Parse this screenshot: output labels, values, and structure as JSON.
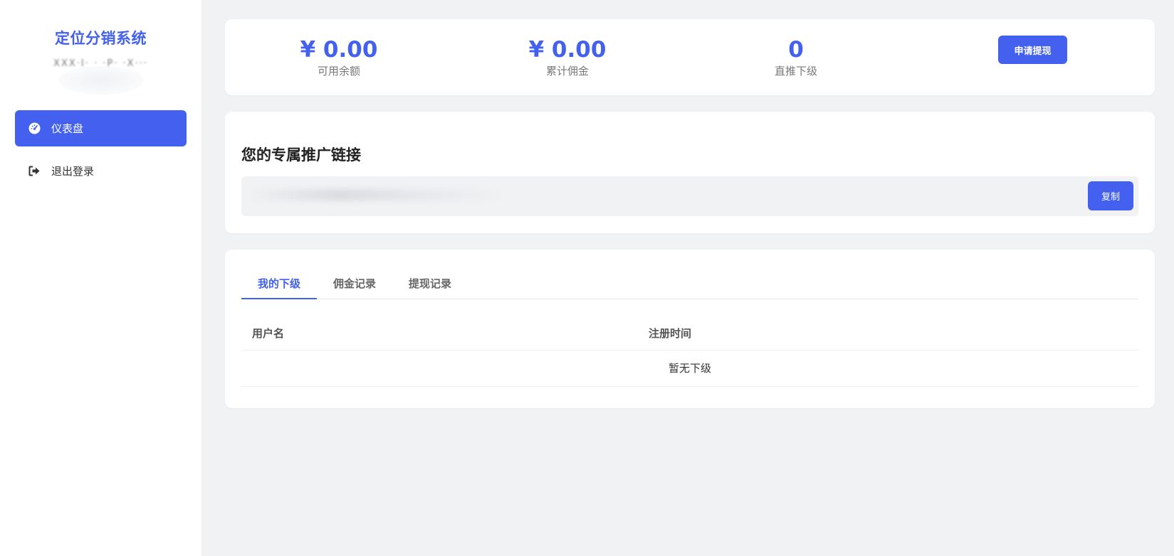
{
  "sidebar": {
    "brand": "定位分销系统",
    "user_name": "XXX·I· · ·P· ·X···",
    "items": [
      {
        "label": "仪表盘",
        "icon": "dashboard-icon",
        "active": true
      },
      {
        "label": "退出登录",
        "icon": "logout-icon",
        "active": false
      }
    ]
  },
  "stats": {
    "balance": {
      "value": "¥ 0.00",
      "label": "可用余额"
    },
    "commission": {
      "value": "¥ 0.00",
      "label": "累计佣金"
    },
    "direct": {
      "value": "0",
      "label": "直推下级"
    },
    "withdraw_label": "申请提现"
  },
  "promo": {
    "title": "您的专属推广链接",
    "link": "",
    "copy_label": "复制"
  },
  "tabs": [
    "我的下级",
    "佣金记录",
    "提现记录"
  ],
  "active_tab": 0,
  "table": {
    "headers": [
      "用户名",
      "注册时间"
    ],
    "empty_text": "暂无下级"
  },
  "colors": {
    "accent": "#4361ee",
    "background": "#f1f2f4"
  }
}
